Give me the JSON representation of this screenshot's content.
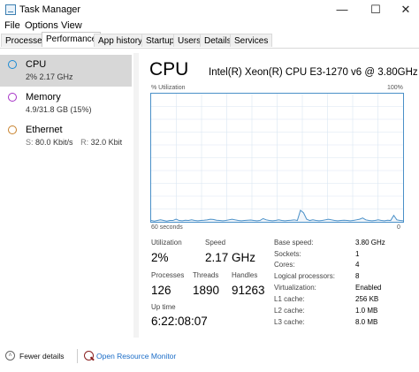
{
  "window": {
    "title": "Task Manager"
  },
  "menu": [
    "File",
    "Options",
    "View"
  ],
  "tabs": [
    "Processes",
    "Performance",
    "App history",
    "Startup",
    "Users",
    "Details",
    "Services"
  ],
  "sidebar": {
    "cpu": {
      "name": "CPU",
      "detail": "2% 2.17 GHz",
      "color": "#1a89d4"
    },
    "memory": {
      "name": "Memory",
      "detail": "4.9/31.8 GB (15%)",
      "color": "#a52fc6"
    },
    "ethernet": {
      "name": "Ethernet",
      "s_label": "S:",
      "s_value": "80.0 Kbit/s",
      "r_label": "R:",
      "r_value": "32.0 Kbit",
      "color": "#c7802a"
    }
  },
  "cpu_panel": {
    "title": "CPU",
    "model": "Intel(R) Xeon(R) CPU E3-1270 v6 @ 3.80GHz",
    "graph_label": "% Utilization",
    "graph_max": "100%",
    "graph_time": "60 seconds",
    "graph_min": "0",
    "graph_color": "#4a90c8",
    "graph_fill": "#f1f6fb",
    "utilization_history": [
      1,
      0.5,
      1,
      1.5,
      1,
      0.5,
      1,
      1,
      2,
      1,
      0.8,
      1.2,
      1,
      1.5,
      1,
      0.8,
      1,
      1.2,
      1.5,
      2,
      1.8,
      1.2,
      1,
      0.8,
      1,
      1.5,
      2,
      1.5,
      1,
      0.8,
      1,
      1.2,
      1.4,
      1,
      0.8,
      1,
      2.5,
      1.5,
      1,
      0.8,
      1,
      1.5,
      1,
      0.8,
      1,
      1.2,
      1.5,
      1,
      9,
      7,
      2,
      1,
      1.5,
      1,
      0.8,
      1,
      1.5,
      2,
      1.5,
      1,
      0.8,
      1,
      1.2,
      1,
      0.8,
      1,
      1.5,
      2,
      3,
      1.5,
      1,
      0.8,
      1,
      1.5,
      1,
      0.8,
      1.2,
      1,
      5,
      1.5,
      1,
      0.8
    ],
    "stats": {
      "utilization_label": "Utilization",
      "utilization": "2%",
      "speed_label": "Speed",
      "speed": "2.17 GHz",
      "processes_label": "Processes",
      "processes": "126",
      "threads_label": "Threads",
      "threads": "1890",
      "handles_label": "Handles",
      "handles": "91263",
      "uptime_label": "Up time",
      "uptime": "6:22:08:07"
    },
    "details": [
      {
        "key": "Base speed:",
        "value": "3.80 GHz"
      },
      {
        "key": "Sockets:",
        "value": "1"
      },
      {
        "key": "Cores:",
        "value": "4"
      },
      {
        "key": "Logical processors:",
        "value": "8"
      },
      {
        "key": "Virtualization:",
        "value": "Enabled"
      },
      {
        "key": "L1 cache:",
        "value": "256 KB"
      },
      {
        "key": "L2 cache:",
        "value": "1.0 MB"
      },
      {
        "key": "L3 cache:",
        "value": "8.0 MB"
      }
    ]
  },
  "footer": {
    "fewer_details": "Fewer details",
    "open_resource_monitor": "Open Resource Monitor"
  }
}
